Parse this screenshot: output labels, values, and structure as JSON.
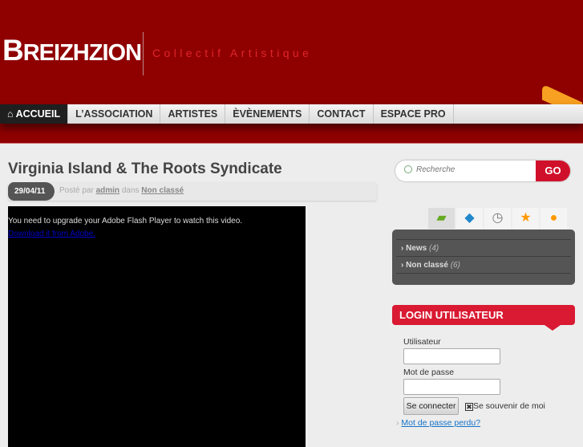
{
  "header": {
    "logo_first": "B",
    "logo_rest": "REIZHZION",
    "tagline": "Collectif Artistique"
  },
  "nav": {
    "items": [
      {
        "label": "ACCUEIL",
        "icon": "home-icon"
      },
      {
        "label": "L’ASSOCIATION"
      },
      {
        "label": "ARTISTES"
      },
      {
        "label": "ÈVÈNEMENTS"
      },
      {
        "label": "CONTACT"
      },
      {
        "label": "ESPACE PRO"
      }
    ]
  },
  "post": {
    "title": "Virginia Island & The Roots Syndicate",
    "date": "29/04/11",
    "posted_by": "Posté par",
    "author": "admin",
    "in": "dans",
    "category": "Non classé",
    "flash_message": "You need to upgrade your Adobe Flash Player to watch this video.",
    "flash_link": "Download it from Adobe."
  },
  "search": {
    "placeholder": "Recherche",
    "go": "GO"
  },
  "sidebar": {
    "tabs": [
      "folder-icon",
      "tag-icon",
      "clock-icon",
      "star-icon",
      "comment-icon"
    ],
    "categories": [
      {
        "name": "News",
        "count": "(4)"
      },
      {
        "name": "Non classé",
        "count": "(6)"
      }
    ]
  },
  "login": {
    "title": "LOGIN UTILISATEUR",
    "user_label": "Utilisateur",
    "pass_label": "Mot de passe",
    "submit": "Se connecter",
    "remember": "Se souvenir de moi",
    "lost": "Mot de passe perdu?"
  },
  "colors": {
    "header": "#8f0000",
    "accent": "#d91a32"
  }
}
